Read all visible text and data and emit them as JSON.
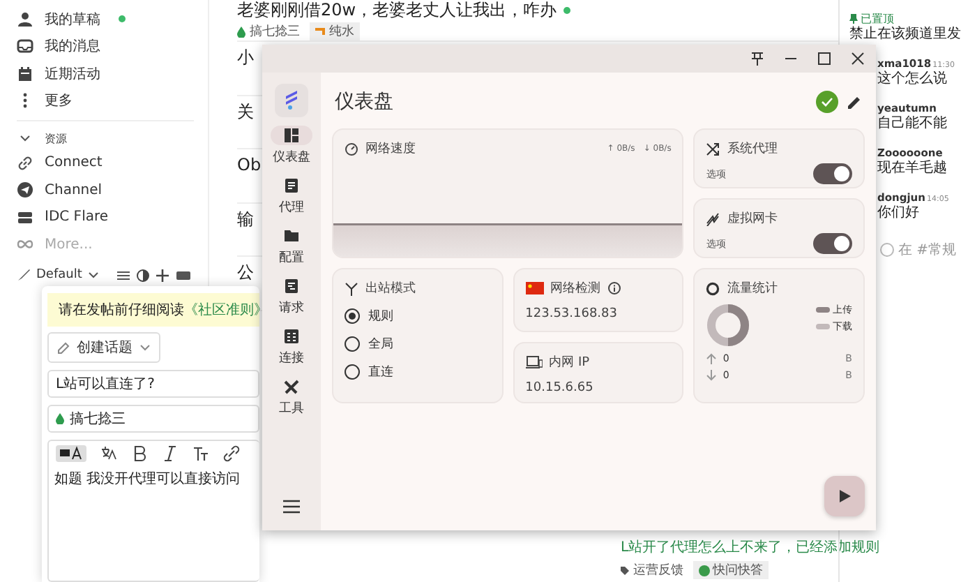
{
  "forum_sidebar": {
    "items": [
      {
        "label": "我的草稿",
        "unread": true
      },
      {
        "label": "我的消息",
        "unread": false
      },
      {
        "label": "近期活动",
        "unread": false
      },
      {
        "label": "更多",
        "unread": false
      }
    ],
    "section": {
      "label": "资源",
      "expanded": true
    },
    "links": [
      "Connect",
      "Channel",
      "IDC Flare",
      "More..."
    ],
    "theme": "Default"
  },
  "topics": [
    {
      "title": "老婆刚刚借20w，老婆老丈人让我出，咋办",
      "unread": true,
      "category": "搞七捻三",
      "tag": "纯水"
    },
    {
      "title": "小",
      "unread": false
    },
    {
      "title": "关",
      "unread": false
    },
    {
      "title": "Ob",
      "unread": false
    },
    {
      "title": "输",
      "unread": false
    },
    {
      "title": "公",
      "unread": false
    }
  ],
  "bottom_topic": {
    "title": "L站开了代理怎么上不来了，已经添加规则",
    "category": "运营反馈",
    "tag": "快问快答"
  },
  "chat": {
    "pinned": {
      "label": "已置顶",
      "text": "禁止在该频道里发"
    },
    "messages": [
      {
        "user": "xma1018",
        "time": "11:30",
        "text": "这个怎么说"
      },
      {
        "user": "yeautumn",
        "text": "自己能不能"
      },
      {
        "user": "Zoooooone",
        "text": "现在羊毛越"
      },
      {
        "user": "dongjun",
        "time": "14:05",
        "text": "你们好"
      }
    ],
    "placeholder": "在 #常规"
  },
  "composer": {
    "banner": "请在发帖前仔细阅读",
    "banner_link": "《社区准则》",
    "action": "创建话题",
    "title": "L站可以直连了?",
    "category": "搞七捻三",
    "body": "如题  我没开代理可以直接访问"
  },
  "app": {
    "nav": [
      {
        "label": "仪表盘",
        "selected": true
      },
      {
        "label": "代理",
        "selected": false
      },
      {
        "label": "配置",
        "selected": false
      },
      {
        "label": "请求",
        "selected": false
      },
      {
        "label": "连接",
        "selected": false
      },
      {
        "label": "工具",
        "selected": false
      }
    ],
    "page_title": "仪表盘",
    "speed": {
      "title": "网络速度",
      "up": "↑ 0B/s",
      "down": "↓ 0B/s"
    },
    "switches": [
      {
        "title": "系统代理",
        "option": "选项",
        "on": true
      },
      {
        "title": "虚拟网卡",
        "option": "选项",
        "on": true
      }
    ],
    "mode": {
      "title": "出站模式",
      "options": [
        {
          "label": "规则",
          "selected": true
        },
        {
          "label": "全局",
          "selected": false
        },
        {
          "label": "直连",
          "selected": false
        }
      ]
    },
    "net_check": {
      "title": "网络检测",
      "ip": "123.53.168.83"
    },
    "lan": {
      "title": "内网 IP",
      "ip": "10.15.6.65"
    },
    "traffic": {
      "title": "流量统计",
      "legend": [
        "上传",
        "下载"
      ],
      "rows": [
        {
          "value": "0",
          "unit": "B"
        },
        {
          "value": "0",
          "unit": "B"
        }
      ]
    }
  }
}
